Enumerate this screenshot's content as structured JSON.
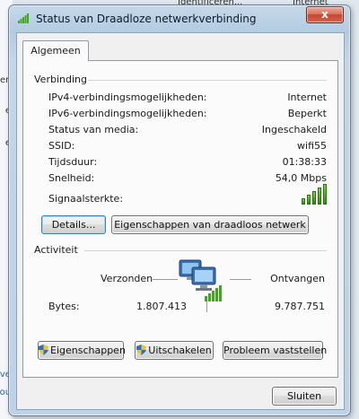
{
  "background": {
    "top_texts": [
      "Identificeren...",
      "Internet"
    ],
    "left_texts": [
      "erk",
      "et",
      "et",
      "",
      "",
      "",
      "",
      "",
      "",
      "",
      "",
      "",
      ""
    ],
    "left_link_texts": [
      "ver",
      "out"
    ]
  },
  "window": {
    "title": "Status van Draadloze netwerkverbinding",
    "close_label": "x"
  },
  "tab": {
    "label": "Algemeen"
  },
  "connection": {
    "section_title": "Verbinding",
    "rows": [
      {
        "label": "IPv4-verbindingsmogelijkheden:",
        "value": "Internet"
      },
      {
        "label": "IPv6-verbindingsmogelijkheden:",
        "value": "Beperkt"
      },
      {
        "label": "Status van media:",
        "value": "Ingeschakeld"
      },
      {
        "label": "SSID:",
        "value": "wifi55"
      },
      {
        "label": "Tijdsduur:",
        "value": "01:38:33"
      },
      {
        "label": "Snelheid:",
        "value": "54,0 Mbps"
      }
    ],
    "signal_label": "Signaalsterkte:",
    "signal_bars_filled": 5,
    "signal_bars_total": 5,
    "details_button": "Details...",
    "wireless_props_button": "Eigenschappen van draadloos netwerk"
  },
  "activity": {
    "section_title": "Activiteit",
    "sent_label": "Verzonden",
    "received_label": "Ontvangen",
    "bytes_label": "Bytes:",
    "bytes_sent": "1.807.413",
    "bytes_received": "9.787.751"
  },
  "actions": {
    "properties": "Eigenschappen",
    "disable": "Uitschakelen",
    "diagnose": "Probleem vaststellen"
  },
  "footer": {
    "close_button": "Sluiten"
  },
  "colors": {
    "signal": "#3fa81c",
    "accent": "#3c7fb1"
  }
}
